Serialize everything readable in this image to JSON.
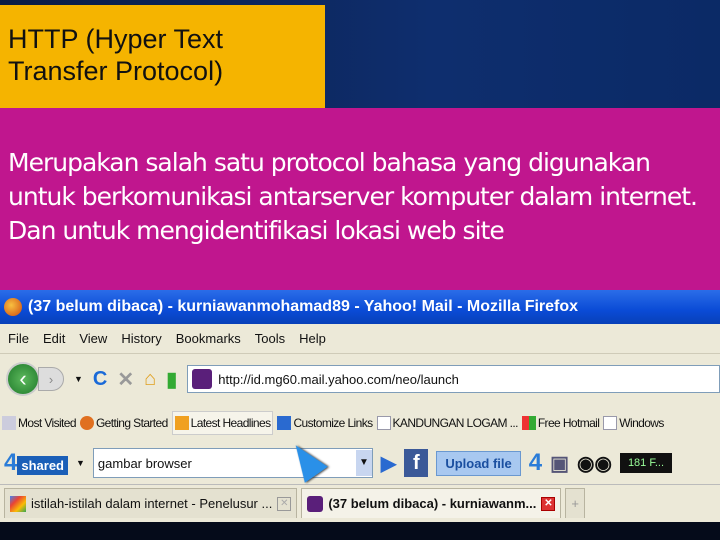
{
  "slide": {
    "title": "HTTP (Hyper Text Transfer Protocol)",
    "body": "Merupakan salah satu protocol bahasa yang digunakan untuk berkomunikasi antarserver komputer dalam internet. Dan untuk mengidentifikasi lokasi web site"
  },
  "browser": {
    "window_title": "(37 belum dibaca) - kurniawanmohamad89 - Yahoo! Mail - Mozilla Firefox",
    "menu": [
      "File",
      "Edit",
      "View",
      "History",
      "Bookmarks",
      "Tools",
      "Help"
    ],
    "url": "http://id.mg60.mail.yahoo.com/neo/launch",
    "bookmarks": [
      "Most Visited",
      "Getting Started",
      "Latest Headlines",
      "Customize Links",
      "KANDUNGAN LOGAM ...",
      "Free Hotmail",
      "Windows"
    ],
    "toolbar": {
      "logo_num": "4",
      "logo_text": "shared",
      "search_value": "gambar browser",
      "upload": "Upload file",
      "radio": "181 F..."
    },
    "tabs": [
      {
        "label": "istilah-istilah dalam internet - Penelusur ..."
      },
      {
        "label": "(37 belum dibaca) - kurniawanm...",
        "active": true
      }
    ],
    "new_tab": "+"
  }
}
